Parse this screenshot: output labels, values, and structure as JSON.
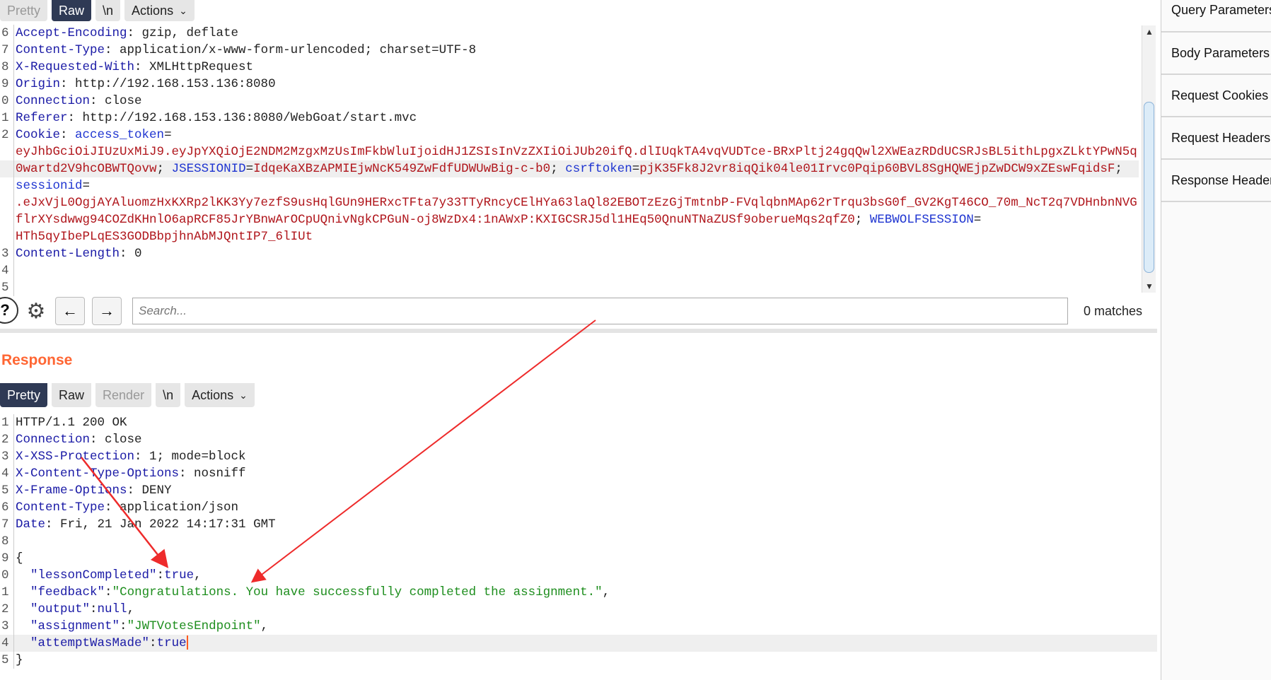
{
  "request": {
    "tabs": [
      {
        "label": "Pretty",
        "state": "dim"
      },
      {
        "label": "Raw",
        "state": "active"
      },
      {
        "label": "\\n",
        "state": ""
      },
      {
        "label": "Actions",
        "state": "",
        "dropdown": true
      }
    ],
    "lines": [
      {
        "num": "6",
        "segs": [
          [
            "key",
            "Accept-Encoding"
          ],
          [
            "val",
            ": gzip, deflate"
          ]
        ]
      },
      {
        "num": "7",
        "segs": [
          [
            "key",
            "Content-Type"
          ],
          [
            "val",
            ": application/x-www-form-urlencoded; charset=UTF-8"
          ]
        ]
      },
      {
        "num": "8",
        "segs": [
          [
            "key",
            "X-Requested-With"
          ],
          [
            "val",
            ": XMLHttpRequest"
          ]
        ]
      },
      {
        "num": "9",
        "segs": [
          [
            "key",
            "Origin"
          ],
          [
            "val",
            ": http://192.168.153.136:8080"
          ]
        ]
      },
      {
        "num": "0",
        "segs": [
          [
            "key",
            "Connection"
          ],
          [
            "val",
            ": close"
          ]
        ]
      },
      {
        "num": "1",
        "segs": [
          [
            "key",
            "Referer"
          ],
          [
            "val",
            ": http://192.168.153.136:8080/WebGoat/start.mvc"
          ]
        ]
      },
      {
        "num": "2",
        "segs": [
          [
            "key",
            "Cookie"
          ],
          [
            "val",
            ": "
          ],
          [
            "blue",
            "access_token"
          ],
          [
            "val",
            "="
          ]
        ]
      },
      {
        "num": "",
        "segs": [
          [
            "red",
            "eyJhbGciOiJIUzUxMiJ9.eyJpYXQiOjE2NDM2MzgxMzUsImFkbWluIjoidHJ1ZSIsInVzZXIiOiJUb20ifQ.dlIUqkTA4vqVUDTce-BRxPltj24gqQwl2XWEazRDdUCSRJsBL5ithLpgxZLktYPwN5q"
          ]
        ]
      },
      {
        "num": "",
        "hl": true,
        "segs": [
          [
            "red",
            "0wartd2V9hcOBWTQovw"
          ],
          [
            "val",
            "; "
          ],
          [
            "blue",
            "JSESSIONID"
          ],
          [
            "val",
            "="
          ],
          [
            "red",
            "IdqeKaXBzAPMIEjwNcK549ZwFdfUDWUwBig-c-b0"
          ],
          [
            "val",
            "; "
          ],
          [
            "blue",
            "csrftoken"
          ],
          [
            "val",
            "="
          ],
          [
            "red",
            "pjK35Fk8J2vr8iqQik04le01Irvc0Pqip60BVL8SgHQWEjpZwDCW9xZEswFqidsF"
          ],
          [
            "val",
            ";"
          ]
        ]
      },
      {
        "num": "",
        "segs": [
          [
            "blue",
            "sessionid"
          ],
          [
            "val",
            "="
          ]
        ]
      },
      {
        "num": "",
        "segs": [
          [
            "red",
            ".eJxVjL0OgjAYAluomzHxKXRp2lKK3Yy7ezfS9usHqlGUn9HERxcTFta7y33TTyRncyCElHYa63laQl82EBOTzEzGjTmtnbP-FVqlqbnMAp62rTrqu3bsG0f_GV2KgT46CO_70m_NcT2q7VDHnbnNVG"
          ]
        ]
      },
      {
        "num": "",
        "segs": [
          [
            "red",
            "flrXYsdwwg94COZdKHnlO6apRCF85JrYBnwArOCpUQnivNgkCPGuN-oj8WzDx4:1nAWxP:KXIGCSRJ5dl1HEq50QnuNTNaZUSf9oberueMqs2qfZ0"
          ],
          [
            "val",
            "; "
          ],
          [
            "blue",
            "WEBWOLFSESSION"
          ],
          [
            "val",
            "="
          ]
        ]
      },
      {
        "num": "",
        "segs": [
          [
            "red",
            "HTh5qyIbePLqES3GODBbpjhnAbMJQntIP7_6lIUt"
          ]
        ]
      },
      {
        "num": "3",
        "segs": [
          [
            "key",
            "Content-Length"
          ],
          [
            "val",
            ": 0"
          ]
        ]
      },
      {
        "num": "4",
        "segs": []
      },
      {
        "num": "5",
        "segs": []
      }
    ]
  },
  "search": {
    "placeholder": "Search...",
    "matches": "0 matches",
    "icons": [
      "help-icon",
      "gear-icon",
      "arrow-left-icon",
      "arrow-right-icon"
    ]
  },
  "response": {
    "title": "Response",
    "tabs": [
      {
        "label": "Pretty",
        "state": "active"
      },
      {
        "label": "Raw",
        "state": ""
      },
      {
        "label": "Render",
        "state": "dim"
      },
      {
        "label": "\\n",
        "state": ""
      },
      {
        "label": "Actions",
        "state": "",
        "dropdown": true
      }
    ],
    "lines": [
      {
        "num": "1",
        "segs": [
          [
            "val",
            "HTTP/1.1 200 OK"
          ]
        ]
      },
      {
        "num": "2",
        "segs": [
          [
            "key",
            "Connection"
          ],
          [
            "val",
            ": close"
          ]
        ]
      },
      {
        "num": "3",
        "segs": [
          [
            "key",
            "X-XSS-Protection"
          ],
          [
            "val",
            ": 1; mode=block"
          ]
        ]
      },
      {
        "num": "4",
        "segs": [
          [
            "key",
            "X-Content-Type-Options"
          ],
          [
            "val",
            ": nosniff"
          ]
        ]
      },
      {
        "num": "5",
        "segs": [
          [
            "key",
            "X-Frame-Options"
          ],
          [
            "val",
            ": DENY"
          ]
        ]
      },
      {
        "num": "6",
        "segs": [
          [
            "key",
            "Content-Type"
          ],
          [
            "val",
            ": application/json"
          ]
        ]
      },
      {
        "num": "7",
        "segs": [
          [
            "key",
            "Date"
          ],
          [
            "val",
            ": Fri, 21 Jan 2022 14:17:31 GMT"
          ]
        ]
      },
      {
        "num": "8",
        "segs": []
      },
      {
        "num": "9",
        "segs": [
          [
            "val",
            "{"
          ]
        ]
      },
      {
        "num": "0",
        "segs": [
          [
            "val",
            "  "
          ],
          [
            "jkey",
            "\"lessonCompleted\""
          ],
          [
            "val",
            ":"
          ],
          [
            "jkey",
            "true"
          ],
          [
            "val",
            ","
          ]
        ]
      },
      {
        "num": "1",
        "segs": [
          [
            "val",
            "  "
          ],
          [
            "jkey",
            "\"feedback\""
          ],
          [
            "val",
            ":"
          ],
          [
            "green",
            "\"Congratulations. You have successfully completed the assignment.\""
          ],
          [
            "val",
            ","
          ]
        ]
      },
      {
        "num": "2",
        "segs": [
          [
            "val",
            "  "
          ],
          [
            "jkey",
            "\"output\""
          ],
          [
            "val",
            ":"
          ],
          [
            "jkey",
            "null"
          ],
          [
            "val",
            ","
          ]
        ]
      },
      {
        "num": "3",
        "segs": [
          [
            "val",
            "  "
          ],
          [
            "jkey",
            "\"assignment\""
          ],
          [
            "val",
            ":"
          ],
          [
            "green",
            "\"JWTVotesEndpoint\""
          ],
          [
            "val",
            ","
          ]
        ]
      },
      {
        "num": "4",
        "hl": true,
        "caret": true,
        "segs": [
          [
            "val",
            "  "
          ],
          [
            "jkey",
            "\"attemptWasMade\""
          ],
          [
            "val",
            ":"
          ],
          [
            "jkey",
            "true"
          ]
        ]
      },
      {
        "num": "5",
        "segs": [
          [
            "val",
            "}"
          ]
        ]
      }
    ]
  },
  "inspector": {
    "items": [
      "Query Parameters",
      "Body Parameters",
      "Request Cookies",
      "Request Headers",
      "Response Headers"
    ]
  },
  "colors": {
    "accent": "#ff6633",
    "active_tab": "#2f3a55",
    "annotation_arrow": "#ee2b2b"
  }
}
